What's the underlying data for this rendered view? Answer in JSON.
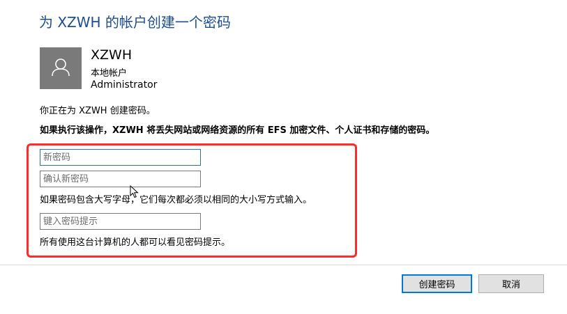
{
  "dialog": {
    "title": "为 XZWH 的帐户创建一个密码"
  },
  "user": {
    "name": "XZWH",
    "account_type": "本地帐户",
    "role": "Administrator",
    "avatar_icon": "user-icon"
  },
  "info_text": "你正在为 XZWH 创建密码。",
  "warning_text": "如果执行该操作，XZWH 将丢失网站或网络资源的所有 EFS 加密文件、个人证书和存储的密码。",
  "form": {
    "new_password": {
      "value": "",
      "placeholder": "新密码"
    },
    "confirm_password": {
      "value": "",
      "placeholder": "确认新密码"
    },
    "case_note": "如果密码包含大写字母，它们每次都必须以相同的大小写方式输入。",
    "hint": {
      "value": "",
      "placeholder": "键入密码提示"
    },
    "hint_note": "所有使用这台计算机的人都可以看见密码提示。"
  },
  "buttons": {
    "create_label": "创建密码",
    "cancel_label": "取消"
  },
  "colors": {
    "title": "#1f4e8c",
    "highlight_border": "#ff2a2a",
    "primary_button_border": "#0078d7",
    "avatar_bg": "#7a7a7a"
  }
}
